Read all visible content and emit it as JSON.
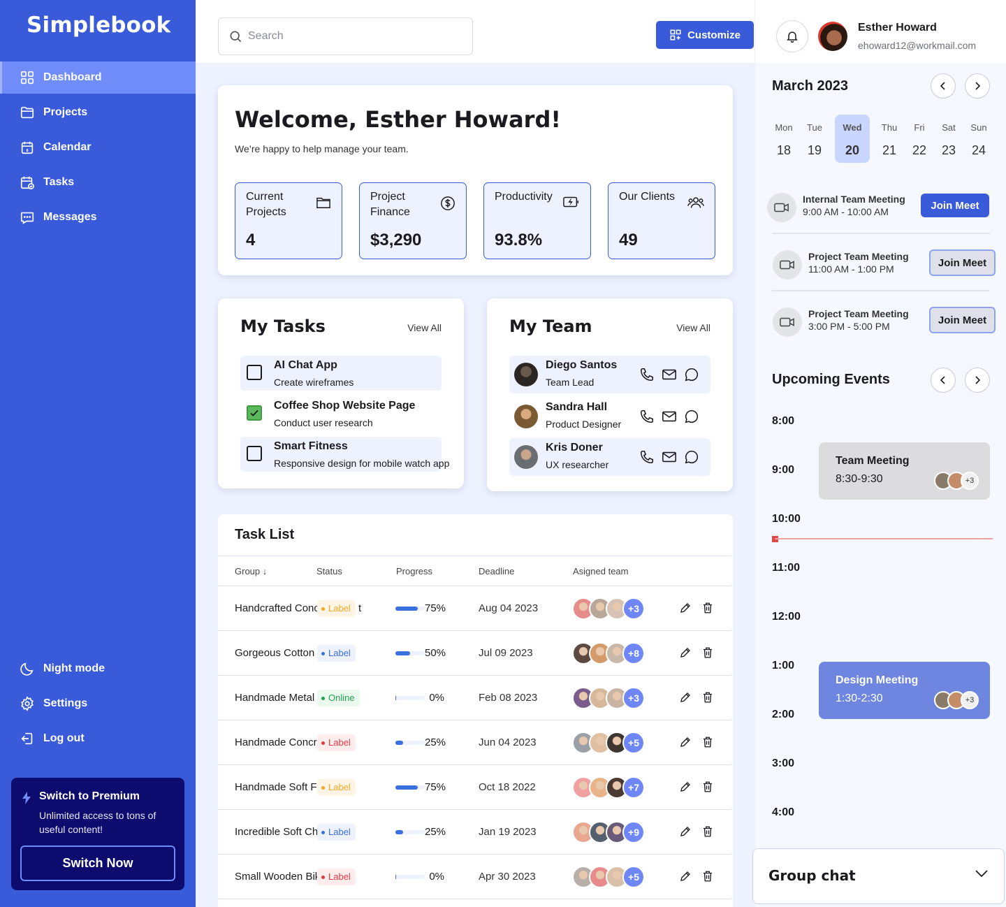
{
  "brand": {
    "name": "Simplebook"
  },
  "sidebar": {
    "nav": [
      {
        "label": "Dashboard",
        "icon": "grid-icon",
        "active": true
      },
      {
        "label": "Projects",
        "icon": "folder-icon"
      },
      {
        "label": "Calendar",
        "icon": "calendar-icon"
      },
      {
        "label": "Tasks",
        "icon": "tasks-calendar-icon"
      },
      {
        "label": "Messages",
        "icon": "chat-icon"
      }
    ],
    "bottom": [
      {
        "label": "Night mode",
        "icon": "moon-icon"
      },
      {
        "label": "Settings",
        "icon": "gear-icon"
      },
      {
        "label": "Log out",
        "icon": "logout-icon"
      }
    ],
    "premium": {
      "title": "Switch to Premium",
      "description": "Unlimited access to tons of useful content!",
      "button": "Switch Now"
    }
  },
  "header": {
    "search_placeholder": "Search",
    "customize_label": "Customize",
    "user": {
      "name": "Esther Howard",
      "email": "ehoward12@workmail.com"
    }
  },
  "welcome": {
    "title": "Welcome, Esther Howard!",
    "subtitle": "We’re happy to help manage your team.",
    "stats": [
      {
        "label": "Current Projects",
        "value": "4",
        "icon": "folder-icon"
      },
      {
        "label": "Project Finance",
        "value": "$3,290",
        "icon": "dollar-circle-icon"
      },
      {
        "label": "Productivity",
        "value": "93.8%",
        "icon": "battery-charging-icon"
      },
      {
        "label": "Our Clients",
        "value": "49",
        "icon": "users-icon"
      }
    ]
  },
  "my_tasks": {
    "title": "My Tasks",
    "view_all": "View All",
    "items": [
      {
        "title": "AI Chat App",
        "subtitle": "Create wireframes",
        "done": false
      },
      {
        "title": "Coffee Shop Website Page",
        "subtitle": "Conduct user research",
        "done": true
      },
      {
        "title": "Smart Fitness",
        "subtitle": "Responsive design for mobile watch app",
        "done": false
      }
    ]
  },
  "my_team": {
    "title": "My Team",
    "view_all": "View All",
    "members": [
      {
        "name": "Diego Santos",
        "role": "Team Lead"
      },
      {
        "name": "Sandra Hall",
        "role": "Product Designer"
      },
      {
        "name": "Kris Doner",
        "role": "UX researcher"
      }
    ]
  },
  "task_list": {
    "title": "Task List",
    "columns": [
      "Group",
      "Status",
      "Progress",
      "Deadline",
      "Asigned team"
    ],
    "rows": [
      {
        "group": "Handcrafted Concrete Hat",
        "tail": "t",
        "status": "Label",
        "status_color": "orange",
        "progress": 75,
        "progress_label": "75%",
        "deadline": "Aug 04 2023",
        "more": "+3"
      },
      {
        "group": "Gorgeous Cotton",
        "tail": "",
        "status": "Label",
        "status_color": "blue",
        "progress": 50,
        "progress_label": "50%",
        "deadline": "Jul 09 2023",
        "more": "+8"
      },
      {
        "group": "Handmade Metal Shirt",
        "tail": "",
        "status": "Online",
        "status_color": "green",
        "progress": 0,
        "progress_label": "0%",
        "deadline": "Feb 08 2023",
        "more": "+3"
      },
      {
        "group": "Handmade Concrete Fish",
        "tail": "",
        "status": "Label",
        "status_color": "red",
        "progress": 25,
        "progress_label": "25%",
        "deadline": "Jun 04 2023",
        "more": "+5"
      },
      {
        "group": "Handmade Soft Fish",
        "tail": "",
        "status": "Label",
        "status_color": "orange",
        "progress": 75,
        "progress_label": "75%",
        "deadline": "Oct 18 2022",
        "more": "+7"
      },
      {
        "group": "Incredible Soft Chair",
        "tail": "",
        "status": "Label",
        "status_color": "blue",
        "progress": 25,
        "progress_label": "25%",
        "deadline": "Jan 19 2023",
        "more": "+9"
      },
      {
        "group": "Small Wooden Bike",
        "tail": "",
        "status": "Label",
        "status_color": "red",
        "progress": 0,
        "progress_label": "0%",
        "deadline": "Apr 30 2023",
        "more": "+5"
      }
    ]
  },
  "calendar": {
    "month": "March 2023",
    "days": [
      {
        "name": "Mon",
        "date": "18"
      },
      {
        "name": "Tue",
        "date": "19"
      },
      {
        "name": "Wed",
        "date": "20",
        "selected": true
      },
      {
        "name": "Thu",
        "date": "21"
      },
      {
        "name": "Fri",
        "date": "22"
      },
      {
        "name": "Sat",
        "date": "23"
      },
      {
        "name": "Sun",
        "date": "24"
      }
    ],
    "meetings": [
      {
        "title": "Internal Team Meeting",
        "time": "9:00  AM - 10:00 AM",
        "button": "Join Meet"
      },
      {
        "title": "Project Team Meeting",
        "time": "11:00  AM - 1:00 PM",
        "button": "Join Meet"
      },
      {
        "title": "Project Team Meeting",
        "time": "3:00  PM - 5:00 PM",
        "button": "Join Meet"
      }
    ]
  },
  "upcoming": {
    "title": "Upcoming Events",
    "hours": [
      "8:00",
      "9:00",
      "10:00",
      "11:00",
      "12:00",
      "1:00",
      "2:00",
      "3:00",
      "4:00"
    ],
    "events": [
      {
        "title": "Team Meeting",
        "time": "8:30-9:30",
        "more": "+3"
      },
      {
        "title": "Design Meeting",
        "time": "1:30-2:30",
        "more": "+3"
      }
    ]
  },
  "group_chat": {
    "title": "Group chat"
  },
  "colors": {
    "primary": "#3a5bd9",
    "accent": "#6f86f6",
    "dark": "#0e0b6e",
    "now_line": "#e04848"
  }
}
